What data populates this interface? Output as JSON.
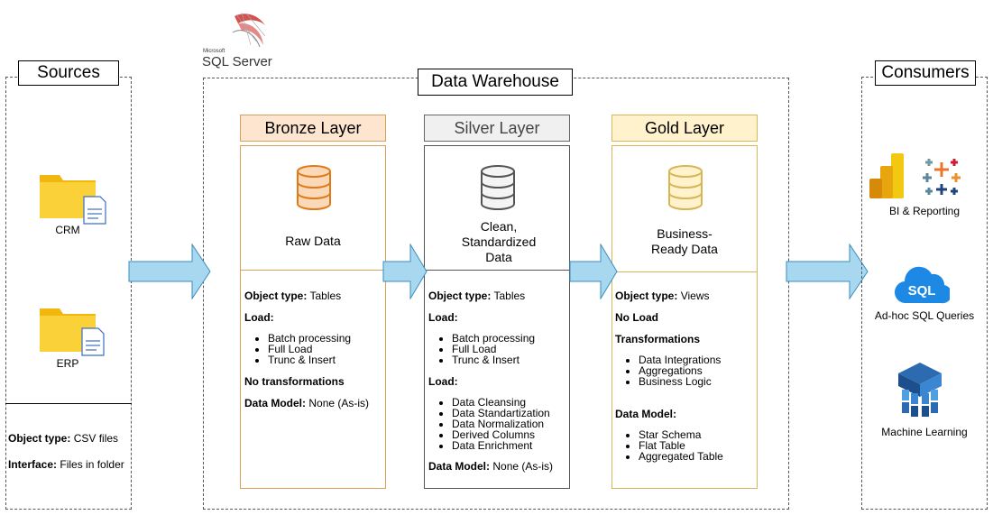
{
  "sql_server": {
    "vendor": "Microsoft",
    "product": "SQL Server"
  },
  "sources": {
    "title": "Sources",
    "items": [
      {
        "label": "CRM"
      },
      {
        "label": "ERP"
      }
    ],
    "object_type_label": "Object type:",
    "object_type_value": "CSV files",
    "interface_label": "Interface:",
    "interface_value": "Files in folder"
  },
  "warehouse": {
    "title": "Data Warehouse",
    "layers": [
      {
        "name": "Bronze Layer",
        "description": "Raw Data",
        "object_type_label": "Object type:",
        "object_type_value": "Tables",
        "load_label": "Load:",
        "load_items": [
          "Batch processing",
          "Full Load",
          "Trunc & Insert"
        ],
        "transform_label": "No transformations",
        "model_label": "Data Model:",
        "model_value": "None (As-is)"
      },
      {
        "name": "Silver Layer",
        "description": "Clean, Standardized Data",
        "object_type_label": "Object type:",
        "object_type_value": "Tables",
        "load_label": "Load:",
        "load_items": [
          "Batch processing",
          "Full Load",
          "Trunc & Insert"
        ],
        "transform_label": "Load:",
        "transform_items": [
          "Data Cleansing",
          "Data Standartization",
          "Data Normalization",
          "Derived Columns",
          "Data Enrichment"
        ],
        "model_label": "Data Model:",
        "model_value": "None (As-is)"
      },
      {
        "name": "Gold Layer",
        "description": "Business-Ready Data",
        "object_type_label": "Object type:",
        "object_type_value": "Views",
        "load_label": "No Load",
        "transform_label": "Transformations",
        "transform_items": [
          "Data Integrations",
          "Aggregations",
          "Business Logic"
        ],
        "model_label": "Data Model:",
        "model_items": [
          "Star Schema",
          "Flat Table",
          "Aggregated Table"
        ]
      }
    ]
  },
  "consumers": {
    "title": "Consumers",
    "items": [
      {
        "label": "BI & Reporting",
        "icons": [
          "power-bi-icon",
          "tableau-icon"
        ]
      },
      {
        "label": "Ad-hoc SQL Queries",
        "icon": "sql-cloud-icon",
        "icon_text": "SQL"
      },
      {
        "label": "Machine Learning",
        "icon": "machine-learning-icon"
      }
    ]
  },
  "colors": {
    "bronze_head": "#fde5d0",
    "bronze_border": "#d9a05b",
    "silver_head": "#f0f0f0",
    "silver_border": "#555555",
    "gold_head": "#fff2cc",
    "gold_border": "#d6b656",
    "arrow_fill": "#a8d8ef",
    "arrow_stroke": "#3a8dbf",
    "folder": "#f8c91c"
  }
}
